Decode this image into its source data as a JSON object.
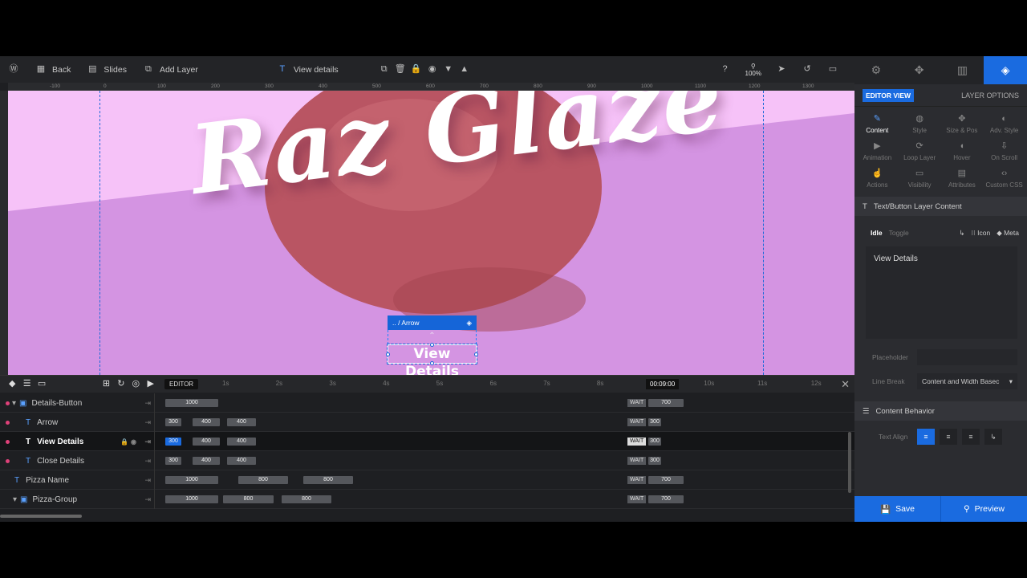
{
  "toolbar": {
    "back": "Back",
    "slides": "Slides",
    "add_layer": "Add Layer",
    "current_layer": "View details",
    "zoom": "100%"
  },
  "ruler": [
    "-100",
    "0",
    "100",
    "200",
    "300",
    "400",
    "500",
    "600",
    "700",
    "800",
    "900",
    "1000",
    "1100",
    "1200",
    "1300"
  ],
  "canvas": {
    "headline": "Raz Glaze",
    "selection_label": ".. / Arrow",
    "button_text": "View Details",
    "bg_top": "#f6c2f8",
    "bg_bottom": "#d494e2",
    "donut": "#b95563"
  },
  "timeline": {
    "editor_label": "EDITOR",
    "ticks": [
      "1s",
      "2s",
      "3s",
      "4s",
      "5s",
      "6s",
      "7s",
      "8s",
      "9s",
      "10s",
      "11s",
      "12s"
    ],
    "timecode": "00:09:00",
    "wait_label": "WAIT",
    "rows": [
      {
        "name": "Details-Button",
        "bars": [
          "1000"
        ],
        "wait": "700"
      },
      {
        "name": "Arrow",
        "bars": [
          "300",
          "400",
          "400"
        ],
        "wait": "300"
      },
      {
        "name": "View Details",
        "bars": [
          "300",
          "400",
          "400"
        ],
        "wait": "300"
      },
      {
        "name": "Close Details",
        "bars": [
          "300",
          "400",
          "400"
        ],
        "wait": "300"
      },
      {
        "name": "Pizza Name",
        "bars": [
          "1000",
          "800",
          "800"
        ],
        "wait": "700"
      },
      {
        "name": "Pizza-Group",
        "bars": [
          "1000",
          "800",
          "800"
        ],
        "wait": "700"
      }
    ]
  },
  "panel": {
    "editor_view": "EDITOR VIEW",
    "layer_options": "LAYER OPTIONS",
    "options": [
      "Content",
      "Style",
      "Size & Pos",
      "Adv. Style",
      "Animation",
      "Loop Layer",
      "Hover",
      "On Scroll",
      "Actions",
      "Visibility",
      "Attributes",
      "Custom CSS"
    ],
    "section_title": "Text/Button Layer Content",
    "idle": "Idle",
    "toggle": "Toggle",
    "icon": "Icon",
    "meta": "Meta",
    "content": "View Details",
    "placeholder_label": "Placeholder",
    "linebreak_label": "Line Break",
    "linebreak_value": "Content and Width Basec",
    "behavior_title": "Content Behavior",
    "text_align_label": "Text Align",
    "save": "Save",
    "preview": "Preview",
    "accent": "#1a6be0"
  }
}
